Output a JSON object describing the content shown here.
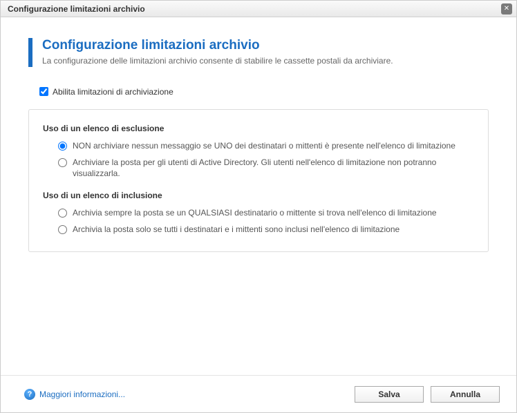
{
  "window": {
    "title": "Configurazione limitazioni archivio"
  },
  "header": {
    "title": "Configurazione limitazioni archivio",
    "subtitle": "La configurazione delle limitazioni archivio consente di stabilire le cassette postali da archiviare."
  },
  "enable_checkbox": {
    "label": "Abilita limitazioni di archiviazione",
    "checked": true
  },
  "exclusion": {
    "title": "Uso di un elenco di esclusione",
    "options": [
      {
        "label": "NON archiviare nessun messaggio se UNO dei destinatari o mittenti è presente nell'elenco di limitazione",
        "selected": true
      },
      {
        "label": "Archiviare la posta per gli utenti di Active Directory. Gli utenti nell'elenco di limitazione non potranno visualizzarla.",
        "selected": false
      }
    ]
  },
  "inclusion": {
    "title": "Uso di un elenco di inclusione",
    "options": [
      {
        "label": "Archivia sempre la posta se un QUALSIASI destinatario o mittente si trova nell'elenco di limitazione",
        "selected": false
      },
      {
        "label": "Archivia la posta solo se tutti i destinatari e i mittenti sono inclusi nell'elenco di limitazione",
        "selected": false
      }
    ]
  },
  "footer": {
    "help_label": "Maggiori informazioni...",
    "save_label": "Salva",
    "cancel_label": "Annulla"
  }
}
